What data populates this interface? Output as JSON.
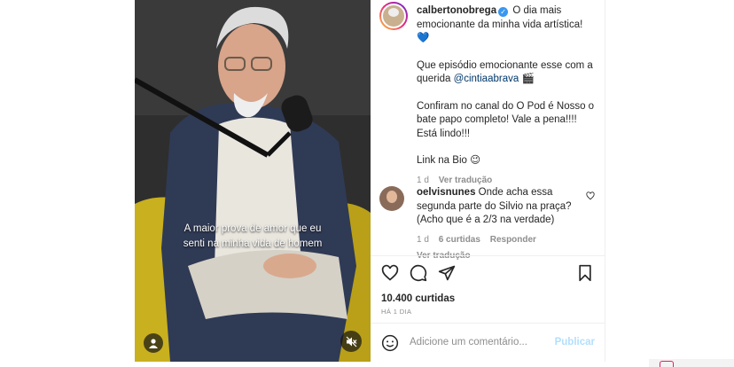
{
  "video": {
    "caption_lines": [
      "A maior prova de amor que eu",
      "senti na minha vida de homem"
    ]
  },
  "post": {
    "username": "calbertonobrega",
    "caption_first": "O dia mais emocionante da minha vida artística!",
    "caption_emoji": "💙",
    "para2_prefix": "Que episódio emocionante esse com a querida ",
    "mention": "@cintiaabrava",
    "para2_suffix": " 🎬",
    "para3": "Confiram no canal do O Pod é Nosso o bate papo completo! Vale a pena!!!! Está lindo!!!",
    "para4": "Link na Bio 😉",
    "time": "1 d",
    "see_translation": "Ver tradução"
  },
  "comment": {
    "username": "oelvisnunes",
    "text": "Onde acha essa segunda parte do Silvio na praça? (Acho que é a 2/3 na verdade)",
    "time": "1 d",
    "likes": "6 curtidas",
    "reply": "Responder",
    "see_translation": "Ver tradução"
  },
  "stats": {
    "likes": "10.400 curtidas",
    "ago": "HÁ 1 DIA"
  },
  "composer": {
    "placeholder": "Adicione um comentário...",
    "publish": "Publicar"
  },
  "colors": {
    "accent": "#3897f0",
    "publish_disabled": "#b2dffc",
    "muted": "#8e8e8e"
  },
  "icons": [
    "heart-icon",
    "comment-icon",
    "share-icon",
    "bookmark-icon",
    "emoji-icon",
    "user-tag-icon",
    "mute-icon",
    "verified-icon"
  ]
}
